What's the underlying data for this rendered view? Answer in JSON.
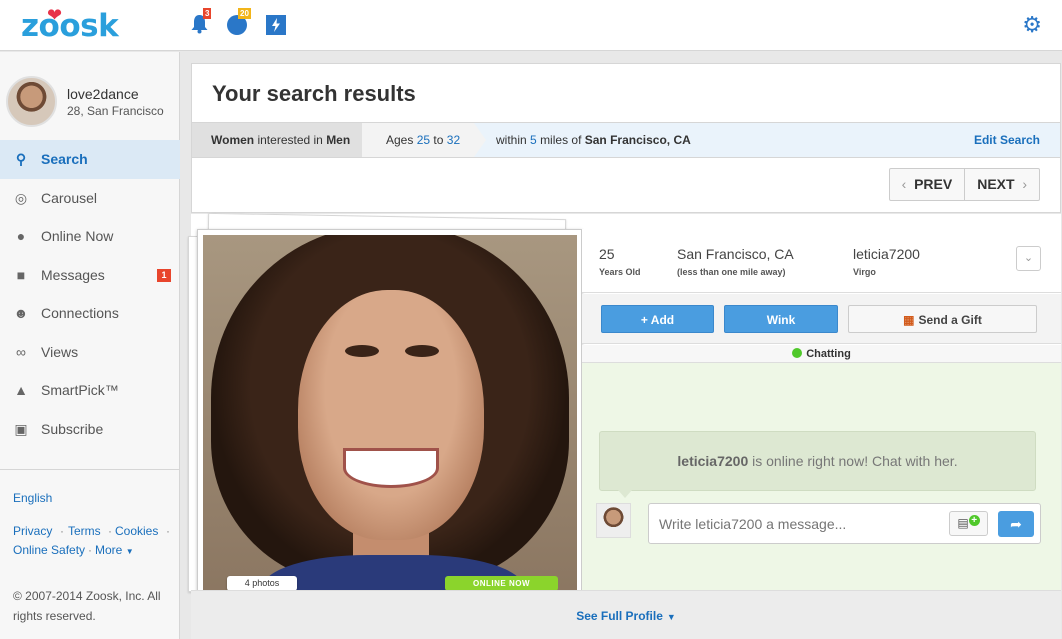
{
  "app": {
    "logo": "zoosk",
    "notifications": {
      "bell_count": "3",
      "chat_count": "20"
    },
    "colors": {
      "brand": "#2a9fdc",
      "accent": "#4a9de0",
      "badge": "#e8452c",
      "online": "#8bd42c"
    }
  },
  "user": {
    "name": "love2dance",
    "info": "28, San Francisco"
  },
  "sidebar": {
    "items": [
      {
        "label": "Search",
        "icon": "search-icon",
        "active": true
      },
      {
        "label": "Carousel",
        "icon": "carousel-icon"
      },
      {
        "label": "Online Now",
        "icon": "chat-bubbles-icon"
      },
      {
        "label": "Messages",
        "icon": "message-icon",
        "badge": "1"
      },
      {
        "label": "Connections",
        "icon": "connections-icon"
      },
      {
        "label": "Views",
        "icon": "glasses-icon"
      },
      {
        "label": "SmartPick™",
        "icon": "flask-icon"
      },
      {
        "label": "Subscribe",
        "icon": "lock-icon"
      }
    ],
    "language": "English",
    "links": {
      "privacy": "Privacy",
      "terms": "Terms",
      "cookies": "Cookies",
      "online_safety": "Online Safety",
      "more": "More"
    },
    "copyright": "© 2007-2014 Zoosk, Inc. All rights reserved."
  },
  "search": {
    "title": "Your search results",
    "filters": {
      "gender_a": "Women",
      "interested": "interested in",
      "gender_b": "Men",
      "ages_label": "Ages",
      "age_min": "25",
      "to": "to",
      "age_max": "32",
      "within": "within",
      "miles": "5",
      "miles_of": "miles of",
      "location": "San Francisco, CA"
    },
    "edit_label": "Edit Search",
    "prev_label": "PREV",
    "next_label": "NEXT"
  },
  "profile": {
    "age": "25",
    "age_label": "Years Old",
    "city": "San Francisco, CA",
    "distance": "(less than one mile away)",
    "username": "leticia7200",
    "sign": "Virgo",
    "photos_label": "4 photos",
    "online_label": "ONLINE NOW"
  },
  "actions": {
    "add": "+ Add",
    "wink": "Wink",
    "gift": "Send a Gift"
  },
  "chat": {
    "status": "Chatting",
    "bubble_user": "leticia7200",
    "bubble_text": " is online right now! Chat with her.",
    "placeholder": "Write leticia7200 a message..."
  },
  "footer": {
    "see_full": "See Full Profile"
  }
}
